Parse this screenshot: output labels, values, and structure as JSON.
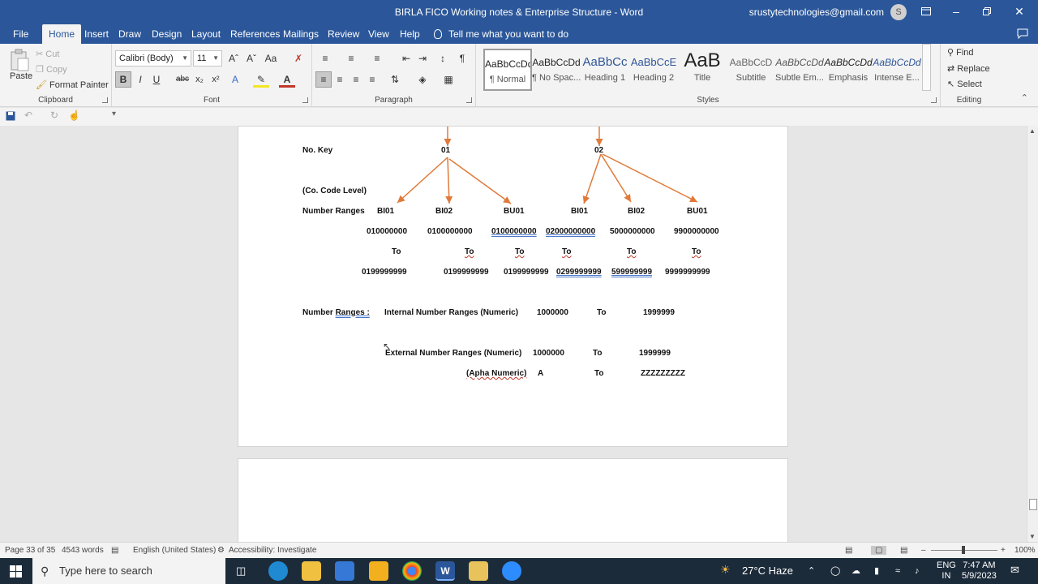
{
  "window": {
    "title": "BIRLA FICO Working notes & Enterprise Structure  -  Word",
    "account": "srustytechnologies@gmail.com",
    "avatar": "S"
  },
  "tabs": [
    "File",
    "Home",
    "Insert",
    "Draw",
    "Design",
    "Layout",
    "References",
    "Mailings",
    "Review",
    "View",
    "Help"
  ],
  "tell_me": "Tell me what you want to do",
  "ribbon": {
    "clipboard": {
      "paste": "Paste",
      "cut": "Cut",
      "copy": "Copy",
      "format_painter": "Format Painter",
      "label": "Clipboard"
    },
    "font": {
      "name": "Calibri (Body)",
      "size": "11",
      "label": "Font"
    },
    "paragraph": {
      "label": "Paragraph"
    },
    "styles": {
      "label": "Styles",
      "items": [
        {
          "sample": "AaBbCcDd",
          "name": "¶ Normal"
        },
        {
          "sample": "AaBbCcDd",
          "name": "¶ No Spac..."
        },
        {
          "sample": "AaBbCc",
          "name": "Heading 1"
        },
        {
          "sample": "AaBbCcE",
          "name": "Heading 2"
        },
        {
          "sample": "AaB",
          "name": "Title"
        },
        {
          "sample": "AaBbCcD",
          "name": "Subtitle"
        },
        {
          "sample": "AaBbCcDd",
          "name": "Subtle Em..."
        },
        {
          "sample": "AaBbCcDd",
          "name": "Emphasis"
        },
        {
          "sample": "AaBbCcDd",
          "name": "Intense E..."
        }
      ]
    },
    "editing": {
      "find": "Find",
      "replace": "Replace",
      "select": "Select",
      "label": "Editing"
    }
  },
  "document": {
    "no_key_label": "No. Key",
    "key_01": "01",
    "key_02": "02",
    "co_code_level": "(Co. Code Level)",
    "number_ranges_label": "Number Ranges",
    "types": [
      "BI01",
      "BI02",
      "BU01",
      "BI01",
      "BI02",
      "BU01"
    ],
    "from": [
      "010000000",
      "0100000000",
      "0100000000",
      "02000000000",
      "5000000000",
      "9900000000"
    ],
    "to_word": "To",
    "to": [
      "0199999999",
      "0199999999",
      "0199999999",
      "0299999999",
      "599999999",
      "9999999999"
    ],
    "nr_prefix": "Number ",
    "nr_underlined": "Ranges :",
    "internal": "Internal Number  Ranges (Numeric)",
    "internal_from": "1000000",
    "internal_to": "1999999",
    "external": "External Number Ranges (Numeric)",
    "external_from": "1000000",
    "external_to": "1999999",
    "alpha": "(Apha Numeric)",
    "alpha_from": "A",
    "alpha_to": "ZZZZZZZZZ"
  },
  "status": {
    "page": "Page 33 of 35",
    "words": "4543 words",
    "language": "English (United States)",
    "accessibility": "Accessibility: Investigate",
    "zoom": "100%"
  },
  "taskbar": {
    "search_placeholder": "Type here to search",
    "weather": "27°C  Haze",
    "lang1": "ENG",
    "lang2": "IN",
    "time": "7:47 AM",
    "date": "5/9/2023"
  },
  "colors": {
    "word_blue": "#2b579a",
    "arrow": "#e07a3a"
  }
}
